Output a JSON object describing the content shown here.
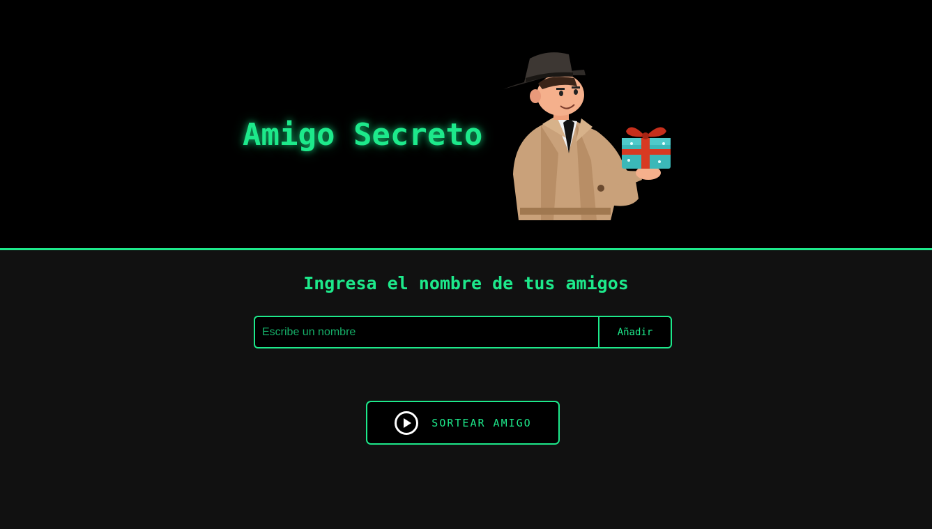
{
  "header": {
    "title": "Amigo Secreto",
    "illustration_icon": "detective-with-gift-illustration"
  },
  "main": {
    "subtitle": "Ingresa el nombre de tus amigos",
    "name_input": {
      "value": "",
      "placeholder": "Escribe un nombre"
    },
    "add_button_label": "Añadir",
    "draw_button": {
      "icon": "play-circle-icon",
      "label": "SORTEAR AMIGO"
    }
  },
  "colors": {
    "accent": "#1de98b",
    "header_background": "#000000",
    "page_background": "#111111"
  }
}
